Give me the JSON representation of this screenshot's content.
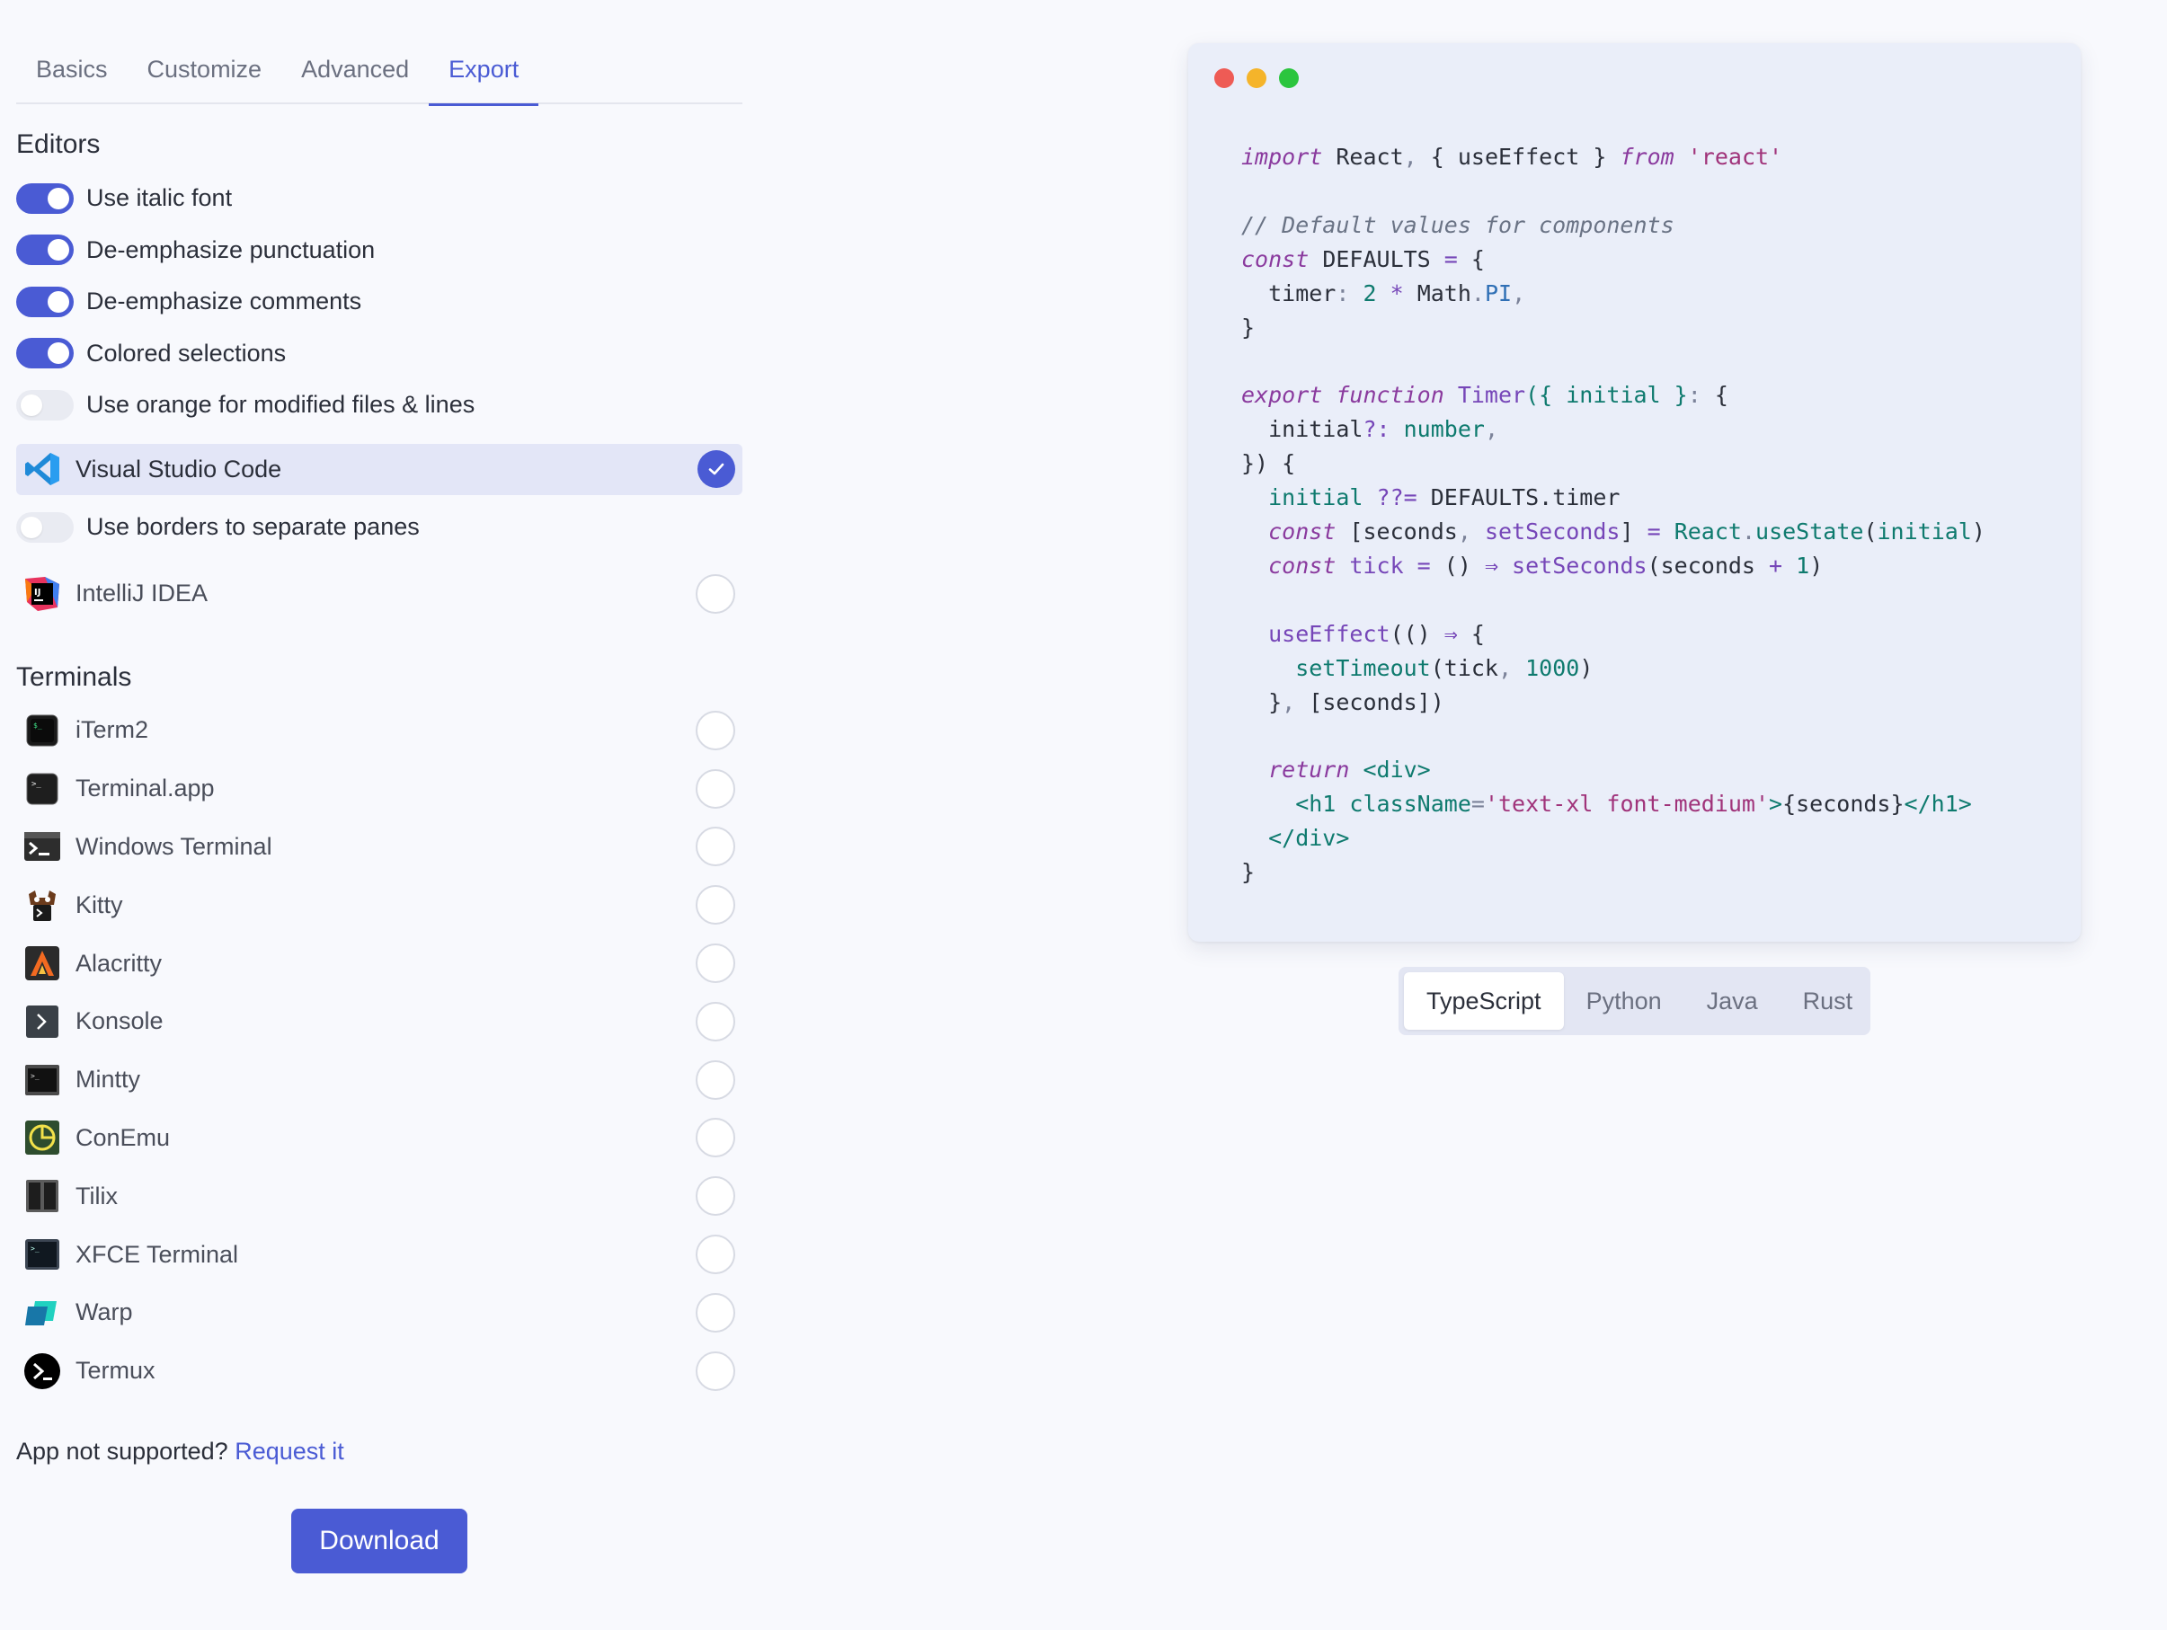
{
  "tabs": [
    {
      "label": "Basics"
    },
    {
      "label": "Customize"
    },
    {
      "label": "Advanced"
    },
    {
      "label": "Export"
    }
  ],
  "editors": {
    "title": "Editors",
    "toggles": [
      {
        "label": "Use italic font",
        "on": true
      },
      {
        "label": "De-emphasize punctuation",
        "on": true
      },
      {
        "label": "De-emphasize comments",
        "on": true
      },
      {
        "label": "Colored selections",
        "on": true
      },
      {
        "label": "Use orange for modified files & lines",
        "on": false
      }
    ],
    "vscode": {
      "label": "Visual Studio Code",
      "selected": true
    },
    "vscode_option": {
      "label": "Use borders to separate panes",
      "on": false
    },
    "intellij": {
      "label": "IntelliJ IDEA",
      "selected": false
    }
  },
  "terminals": {
    "title": "Terminals",
    "items": [
      {
        "label": "iTerm2"
      },
      {
        "label": "Terminal.app"
      },
      {
        "label": "Windows Terminal"
      },
      {
        "label": "Kitty"
      },
      {
        "label": "Alacritty"
      },
      {
        "label": "Konsole"
      },
      {
        "label": "Mintty"
      },
      {
        "label": "ConEmu"
      },
      {
        "label": "Tilix"
      },
      {
        "label": "XFCE Terminal"
      },
      {
        "label": "Warp"
      },
      {
        "label": "Termux"
      }
    ]
  },
  "footer": {
    "request_prefix": "App not supported?",
    "request_link": "Request it",
    "download_label": "Download"
  },
  "preview": {
    "code": {
      "l1_a": "import",
      "l1_b": " React",
      "l1_c": ",",
      "l1_d": " { useEffect } ",
      "l1_e": "from",
      "l1_f": " 'react'",
      "l3": "// Default values for components",
      "l4_a": "const",
      "l4_b": " DEFAULTS ",
      "l4_c": "=",
      "l4_d": " {",
      "l5_a": "  timer",
      "l5_b": ":",
      "l5_c": " 2",
      "l5_d": " *",
      "l5_e": " Math",
      "l5_f": ".",
      "l5_g": "PI",
      "l5_h": ",",
      "l6": "}",
      "l8_a": "export",
      "l8_b": " function",
      "l8_c": " Timer",
      "l8_d": "({",
      "l8_e": " initial",
      "l8_f": " }",
      "l8_g": ":",
      "l8_h": " {",
      "l9_a": "  initial",
      "l9_b": "?:",
      "l9_c": " number",
      "l9_d": ",",
      "l10": "}) {",
      "l11_a": "  initial",
      "l11_b": " ??=",
      "l11_c": " DEFAULTS.timer",
      "l12_a": "  const",
      "l12_b": " [seconds",
      "l12_c": ",",
      "l12_d": " setSeconds",
      "l12_e": "]",
      "l12_f": " =",
      "l12_g": " React",
      "l12_h": ".",
      "l12_i": "useState",
      "l12_j": "(",
      "l12_k": "initial",
      "l12_l": ")",
      "l13_a": "  const",
      "l13_b": " tick",
      "l13_c": " =",
      "l13_d": " ()",
      "l13_e": " ⇒",
      "l13_f": " setSeconds",
      "l13_g": "(seconds",
      "l13_h": " +",
      "l13_i": " 1",
      "l13_j": ")",
      "l15_a": "  useEffect",
      "l15_b": "(()",
      "l15_c": " ⇒",
      "l15_d": " {",
      "l16_a": "    setTimeout",
      "l16_b": "(tick",
      "l16_c": ",",
      "l16_d": " 1000",
      "l16_e": ")",
      "l17_a": "  }",
      "l17_b": ",",
      "l17_c": " [seconds])",
      "l19_a": "  return",
      "l19_b": " <div>",
      "l20_a": "    <h1",
      "l20_b": " className",
      "l20_c": "=",
      "l20_d": "'text-xl font-medium'",
      "l20_e": ">",
      "l20_f": "{seconds}",
      "l20_g": "</h1>",
      "l21": "  </div>",
      "l22": "}"
    },
    "languages": [
      {
        "label": "TypeScript",
        "active": true
      },
      {
        "label": "Python",
        "active": false
      },
      {
        "label": "Java",
        "active": false
      },
      {
        "label": "Rust",
        "active": false
      }
    ],
    "window_dots": [
      "#ee5b55",
      "#f5b42a",
      "#2bc53e"
    ]
  },
  "colors": {
    "accent": "#4a5bd4"
  }
}
